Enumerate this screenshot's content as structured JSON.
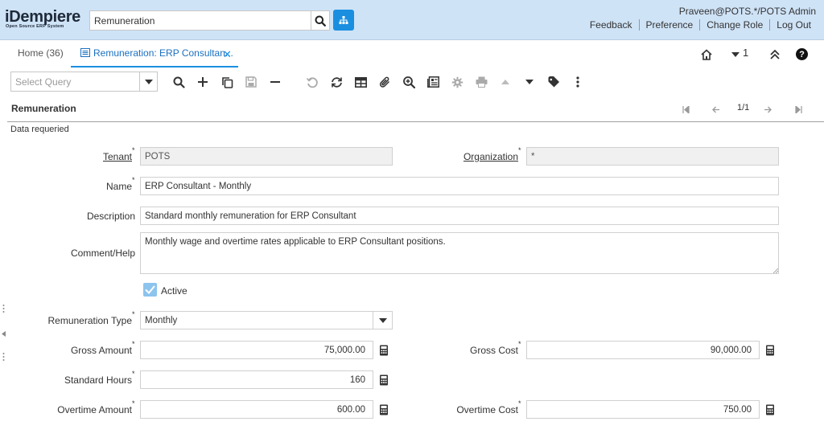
{
  "header": {
    "logo_main": "iDempiere",
    "logo_sub": "Open Source ERP System",
    "search_value": "Remuneration",
    "user": "Praveen@POTS.*/POTS Admin",
    "links": [
      "Feedback",
      "Preference",
      "Change Role",
      "Log Out"
    ]
  },
  "tabs": {
    "home": "Home (36)",
    "active": "Remuneration: ERP Consultan...",
    "count": "1"
  },
  "toolbar": {
    "query_placeholder": "Select Query"
  },
  "window": {
    "title": "Remuneration",
    "record_count": "1/1",
    "status": "Data requeried"
  },
  "form": {
    "tenant_label": "Tenant",
    "tenant_value": "POTS",
    "org_label": "Organization",
    "org_value": "*",
    "name_label": "Name",
    "name_value": "ERP Consultant - Monthly",
    "description_label": "Description",
    "description_value": "Standard monthly remuneration for ERP Consultant",
    "comment_label": "Comment/Help",
    "comment_value": "Monthly wage and overtime rates applicable to ERP Consultant  positions.",
    "active_label": "Active",
    "active_checked": true,
    "rem_type_label": "Remuneration Type",
    "rem_type_value": "Monthly",
    "gross_amount_label": "Gross Amount",
    "gross_amount_value": "75,000.00",
    "gross_cost_label": "Gross Cost",
    "gross_cost_value": "90,000.00",
    "std_hours_label": "Standard Hours",
    "std_hours_value": "160",
    "ot_amount_label": "Overtime Amount",
    "ot_amount_value": "600.00",
    "ot_cost_label": "Overtime Cost",
    "ot_cost_value": "750.00"
  },
  "colors": {
    "header_bg": "#cfe3f7",
    "accent": "#1a8fe0",
    "checkbox": "#8cc4ee"
  }
}
